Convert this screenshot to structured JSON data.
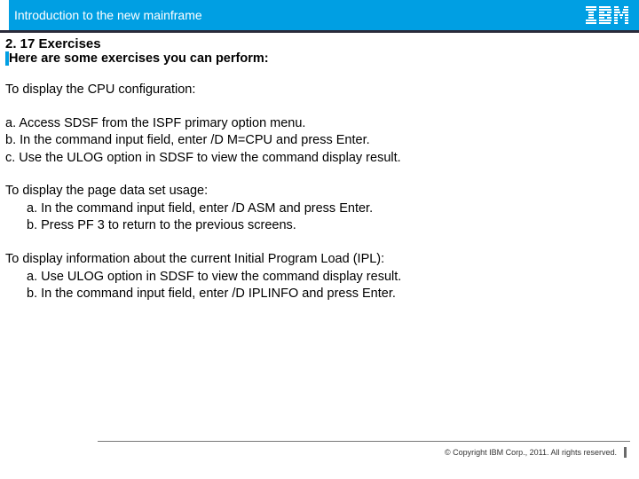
{
  "header": {
    "title": "Introduction to the new mainframe",
    "logo_name": "IBM"
  },
  "section": {
    "heading": "2. 17 Exercises",
    "intro": "Here are some exercises you can perform:"
  },
  "exercises": [
    {
      "title": "To display the CPU configuration:",
      "steps": [
        "a. Access SDSF from the ISPF primary option menu.",
        "b. In the command input field, enter /D M=CPU and press Enter.",
        "c. Use the ULOG option in SDSF to view the command display result."
      ],
      "indent": false
    },
    {
      "title": "To display the page data set usage:",
      "steps": [
        "a. In the command input field, enter /D ASM and press Enter.",
        "b. Press PF 3 to return to the previous screens."
      ],
      "indent": true
    },
    {
      "title": "To display information about the current Initial Program Load (IPL):",
      "steps": [
        "a. Use ULOG option in SDSF to view the command display result.",
        "b. In the command input field, enter /D IPLINFO and press Enter."
      ],
      "indent": true
    }
  ],
  "footer": {
    "copyright": "© Copyright IBM Corp., 2011. All rights reserved."
  }
}
